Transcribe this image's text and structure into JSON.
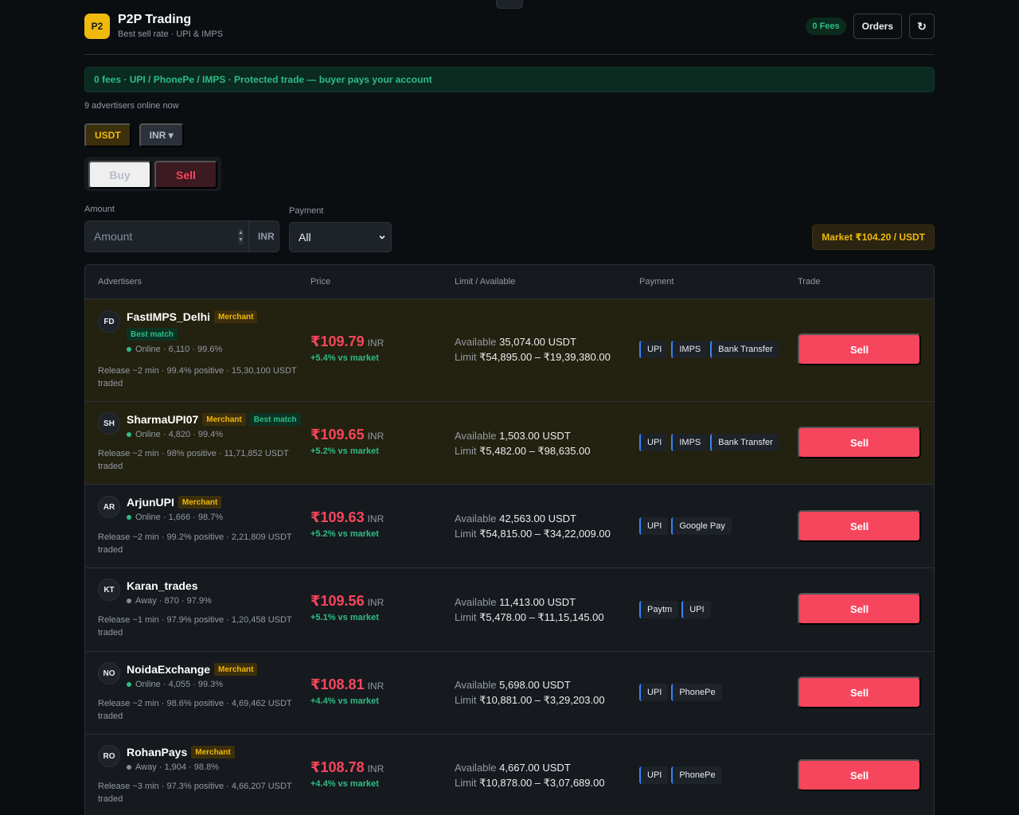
{
  "header": {
    "logo": "P2",
    "title": "P2P Trading",
    "subtitle": "Best sell rate · UPI & IMPS",
    "fees_badge": "0 Fees",
    "orders_label": "Orders",
    "refresh_icon": "↻"
  },
  "banner": "0 fees · UPI / PhonePe / IMPS · Protected trade — buyer pays your account",
  "online_text": "9 advertisers online now",
  "asset": {
    "crypto": "USDT",
    "fiat": "INR ▾"
  },
  "side": {
    "buy": "Buy",
    "sell": "Sell",
    "selected": "sell"
  },
  "filters": {
    "amount_label": "Amount",
    "amount_placeholder": "Amount",
    "amount_unit": "INR",
    "payment_label": "Payment",
    "payment_value": "All"
  },
  "market": "Market ₹104.20 / USDT",
  "table": {
    "headers": [
      "Advertisers",
      "Price",
      "Limit / Available",
      "Payment",
      "Trade"
    ],
    "rows": [
      {
        "initials": "FD",
        "name": "FastIMPS_Delhi",
        "tags": [
          "Merchant",
          "Best match"
        ],
        "best": true,
        "status": "Online",
        "status_text": "Online · 6,110 · 99.6%",
        "release": "Release ~2 min · 99.4% positive · 15,30,100 USDT traded",
        "price": "₹109.79",
        "unit": "INR",
        "diff": "+5.4% vs market",
        "available_label": "Available",
        "available": "35,074.00 USDT",
        "limit_label": "Limit",
        "limit": "₹54,895.00 – ₹19,39,380.00",
        "payments": [
          "UPI",
          "IMPS",
          "Bank Transfer"
        ],
        "action": "Sell"
      },
      {
        "initials": "SH",
        "name": "SharmaUPI07",
        "tags": [
          "Merchant",
          "Best match"
        ],
        "best": true,
        "status": "Online",
        "status_text": "Online · 4,820 · 99.4%",
        "release": "Release ~2 min · 98% positive · 11,71,852 USDT traded",
        "price": "₹109.65",
        "unit": "INR",
        "diff": "+5.2% vs market",
        "available_label": "Available",
        "available": "1,503.00 USDT",
        "limit_label": "Limit",
        "limit": "₹5,482.00 – ₹98,635.00",
        "payments": [
          "UPI",
          "IMPS",
          "Bank Transfer"
        ],
        "action": "Sell"
      },
      {
        "initials": "AR",
        "name": "ArjunUPI",
        "tags": [
          "Merchant"
        ],
        "best": false,
        "status": "Online",
        "status_text": "Online · 1,666 · 98.7%",
        "release": "Release ~2 min · 99.2% positive · 2,21,809 USDT traded",
        "price": "₹109.63",
        "unit": "INR",
        "diff": "+5.2% vs market",
        "available_label": "Available",
        "available": "42,563.00 USDT",
        "limit_label": "Limit",
        "limit": "₹54,815.00 – ₹34,22,009.00",
        "payments": [
          "UPI",
          "Google Pay"
        ],
        "action": "Sell"
      },
      {
        "initials": "KT",
        "name": "Karan_trades",
        "tags": [],
        "best": false,
        "status": "Away",
        "status_text": "Away · 870 · 97.9%",
        "release": "Release ~1 min · 97.9% positive · 1,20,458 USDT traded",
        "price": "₹109.56",
        "unit": "INR",
        "diff": "+5.1% vs market",
        "available_label": "Available",
        "available": "11,413.00 USDT",
        "limit_label": "Limit",
        "limit": "₹5,478.00 – ₹11,15,145.00",
        "payments": [
          "Paytm",
          "UPI"
        ],
        "action": "Sell"
      },
      {
        "initials": "NO",
        "name": "NoidaExchange",
        "tags": [
          "Merchant"
        ],
        "best": false,
        "status": "Online",
        "status_text": "Online · 4,055 · 99.3%",
        "release": "Release ~2 min · 98.6% positive · 4,69,462 USDT traded",
        "price": "₹108.81",
        "unit": "INR",
        "diff": "+4.4% vs market",
        "available_label": "Available",
        "available": "5,698.00 USDT",
        "limit_label": "Limit",
        "limit": "₹10,881.00 – ₹3,29,203.00",
        "payments": [
          "UPI",
          "PhonePe"
        ],
        "action": "Sell"
      },
      {
        "initials": "RO",
        "name": "RohanPays",
        "tags": [
          "Merchant"
        ],
        "best": false,
        "status": "Away",
        "status_text": "Away · 1,904 · 98.8%",
        "release": "Release ~3 min · 97.3% positive · 4,66,207 USDT traded",
        "price": "₹108.78",
        "unit": "INR",
        "diff": "+4.4% vs market",
        "available_label": "Available",
        "available": "4,667.00 USDT",
        "limit_label": "Limit",
        "limit": "₹10,878.00 – ₹3,07,689.00",
        "payments": [
          "UPI",
          "PhonePe"
        ],
        "action": "Sell"
      }
    ]
  }
}
